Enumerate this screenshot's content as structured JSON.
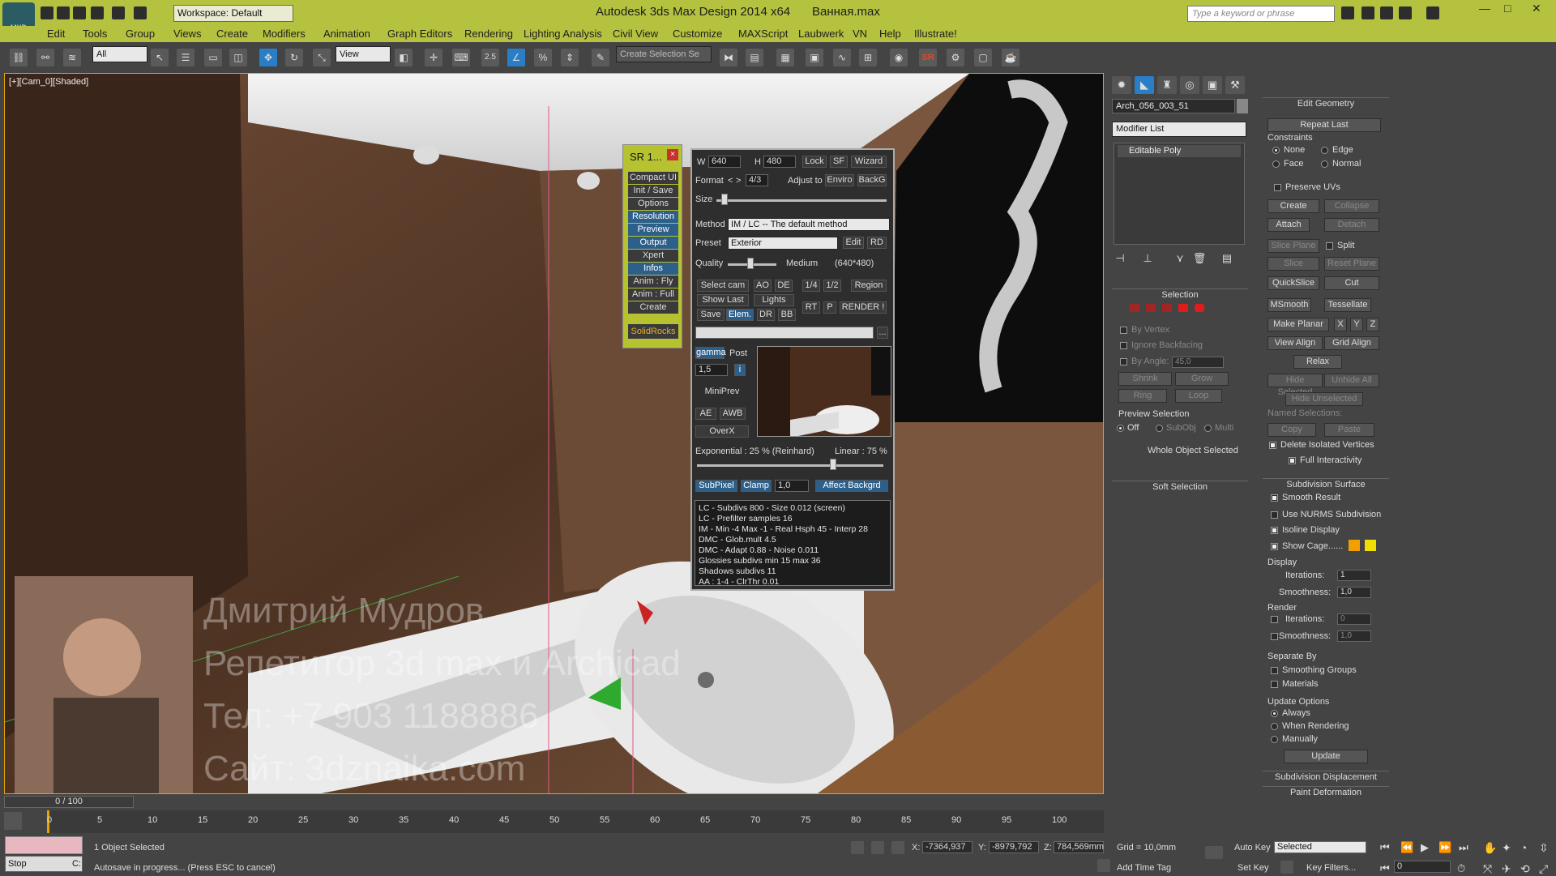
{
  "titlebar": {
    "app_title": "Autodesk 3ds Max Design 2014 x64",
    "file_name": "Ванная.max",
    "workspace": "Workspace: Default",
    "search_placeholder": "Type a keyword or phrase",
    "logo": "MXD"
  },
  "menu": [
    "Edit",
    "Tools",
    "Group",
    "Views",
    "Create",
    "Modifiers",
    "Animation",
    "Graph Editors",
    "Rendering",
    "Lighting Analysis",
    "Civil View",
    "Customize",
    "MAXScript",
    "Laubwerk",
    "VN",
    "Help",
    "Illustrate!"
  ],
  "toolbar": {
    "selection_filter": "All",
    "ref_coord": "View",
    "selection_set": "Create Selection Se",
    "snap_value": "2.5",
    "sr_label": "SR"
  },
  "viewport": {
    "label": "[+][Cam_0][Shaded]",
    "watermark": [
      "Дмитрий Мудров",
      "Репетитор 3d max и Archicad",
      "Тел: +7 903 1188886",
      "Сайт: 3dznaika.com"
    ]
  },
  "sr_panel": {
    "title": "SR 1...",
    "close": "×",
    "buttons": [
      {
        "label": "Compact UI",
        "active": false
      },
      {
        "label": "Init / Save",
        "active": false
      },
      {
        "label": "Options",
        "active": false
      },
      {
        "label": "Resolution",
        "active": true
      },
      {
        "label": "Preview",
        "active": true
      },
      {
        "label": "Output",
        "active": true
      },
      {
        "label": "Xpert",
        "active": false
      },
      {
        "label": "Infos",
        "active": true
      },
      {
        "label": "Anim : Fly",
        "active": false
      },
      {
        "label": "Anim : Full",
        "active": false
      },
      {
        "label": "Create",
        "active": false
      }
    ],
    "brand": "SolidRocks"
  },
  "render_popup": {
    "w_label": "W",
    "w_value": "640",
    "h_label": "H",
    "h_value": "480",
    "lock": "Lock",
    "sf": "SF",
    "wizard": "Wizard",
    "format_label": "Format",
    "format_prev": "<",
    "format_next": ">",
    "format_value": "4/3",
    "adjust_label": "Adjust to",
    "enviro": "Enviro",
    "backg": "BackG",
    "size_label": "Size",
    "method_label": "Method",
    "method_value": "IM / LC -- The default method",
    "preset_label": "Preset",
    "preset_value": "Exterior",
    "edit": "Edit",
    "rd": "RD",
    "quality_label": "Quality",
    "quality_value": "Medium",
    "quality_res": "(640*480)",
    "select_cam": "Select cam",
    "ao": "AO",
    "de": "DE",
    "q14": "1/4",
    "q12": "1/2",
    "region": "Region",
    "show_last": "Show Last",
    "lights": "Lights",
    "save": "Save",
    "elem": "Elem.",
    "dr": "DR",
    "bb": "BB",
    "rt": "RT",
    "p": "P",
    "render": "RENDER !",
    "more": "...",
    "gamma": "gamma",
    "post": "Post",
    "gamma_value": "1,5",
    "i": "i",
    "miniprev": "MiniPrev",
    "ae": "AE",
    "awb": "AWB",
    "overx": "OverX",
    "exposure_left": "Exponential : 25 %  (Reinhard)",
    "exposure_right": "Linear : 75 %",
    "subpixel": "SubPixel",
    "clamp": "Clamp",
    "clamp_value": "1,0",
    "affect": "Affect Backgrd",
    "info_lines": [
      "LC - Subdivs 800 - Size 0.012 (screen)",
      "LC - Prefilter samples 16",
      "IM - Min -4 Max -1 - Real Hsph 45 - Interp 28",
      "DMC - Glob.mult 4.5",
      "DMC - Adapt 0.88 - Noise 0.011",
      "Glossies subdivs min 15 max 36",
      "Shadows subdivs 11",
      "AA : 1-4 - ClrThr 0.01"
    ]
  },
  "command_panel": {
    "object_name": "Arch_056_003_51",
    "modifier_list": "Modifier List",
    "stack_item": "Editable Poly",
    "selection": {
      "title": "Selection",
      "by_vertex": "By Vertex",
      "ignore_backfacing": "Ignore Backfacing",
      "by_angle": "By Angle:",
      "angle_value": "45,0",
      "shrink": "Shrink",
      "grow": "Grow",
      "ring": "Ring",
      "loop": "Loop",
      "preview_label": "Preview Selection",
      "off": "Off",
      "subobj": "SubObj",
      "multi": "Multi",
      "status": "Whole Object Selected"
    },
    "soft_selection": "Soft Selection",
    "edit_geometry": {
      "title": "Edit Geometry",
      "repeat_last": "Repeat Last",
      "constraints": "Constraints",
      "none": "None",
      "edge": "Edge",
      "face": "Face",
      "normal": "Normal",
      "preserve_uvs": "Preserve UVs",
      "create": "Create",
      "collapse": "Collapse",
      "attach": "Attach",
      "detach": "Detach",
      "slice_plane": "Slice Plane",
      "split": "Split",
      "slice": "Slice",
      "reset_plane": "Reset Plane",
      "quickslice": "QuickSlice",
      "cut": "Cut",
      "msmooth": "MSmooth",
      "tessellate": "Tessellate",
      "make_planar": "Make Planar",
      "x": "X",
      "y": "Y",
      "z": "Z",
      "view_align": "View Align",
      "grid_align": "Grid Align",
      "relax": "Relax",
      "hide_selected": "Hide Selected",
      "unhide_all": "Unhide All",
      "hide_unselected": "Hide Unselected",
      "named_selections": "Named Selections:",
      "copy": "Copy",
      "paste": "Paste",
      "delete_isolated": "Delete Isolated Vertices",
      "full_interactivity": "Full Interactivity"
    },
    "subdivision": {
      "title": "Subdivision Surface",
      "smooth_result": "Smooth Result",
      "use_nurms": "Use NURMS Subdivision",
      "isoline": "Isoline Display",
      "show_cage": "Show Cage......",
      "display": "Display",
      "iterations": "Iterations:",
      "iter_value": "1",
      "smoothness": "Smoothness:",
      "smooth_value": "1,0",
      "render": "Render",
      "r_iter_value": "0",
      "r_smooth_value": "1,0",
      "separate_by": "Separate By",
      "smoothing_groups": "Smoothing Groups",
      "materials": "Materials",
      "update_options": "Update Options",
      "always": "Always",
      "when_rendering": "When Rendering",
      "manually": "Manually",
      "update": "Update"
    },
    "subdivision_displacement": "Subdivision Displacement",
    "paint_deformation": "Paint Deformation"
  },
  "timeline": {
    "slider_label": "0 / 100",
    "ticks": [
      "0",
      "5",
      "10",
      "15",
      "20",
      "25",
      "30",
      "35",
      "40",
      "45",
      "50",
      "55",
      "60",
      "65",
      "70",
      "75",
      "80",
      "85",
      "90",
      "95",
      "100"
    ]
  },
  "statusbar": {
    "selected_count": "1 Object Selected",
    "prompt": "Autosave in progress... (Press ESC to cancel)",
    "stop": "Stop",
    "stop_value": "C:",
    "x_label": "X:",
    "x_value": "-7364,937",
    "y_label": "Y:",
    "y_value": "-8979,792",
    "z_label": "Z:",
    "z_value": "784,569mm",
    "grid": "Grid = 10,0mm",
    "add_time_tag": "Add Time Tag",
    "auto_key": "Auto Key",
    "set_key": "Set Key",
    "key_filters": "Key Filters...",
    "key_mode": "Selected",
    "frame": "0"
  },
  "colors": {
    "title_bar": "#b5c23f",
    "active_blue": "#2d5f8b",
    "cage_orange": "#f0a000",
    "cage_yellow": "#f0e000"
  }
}
